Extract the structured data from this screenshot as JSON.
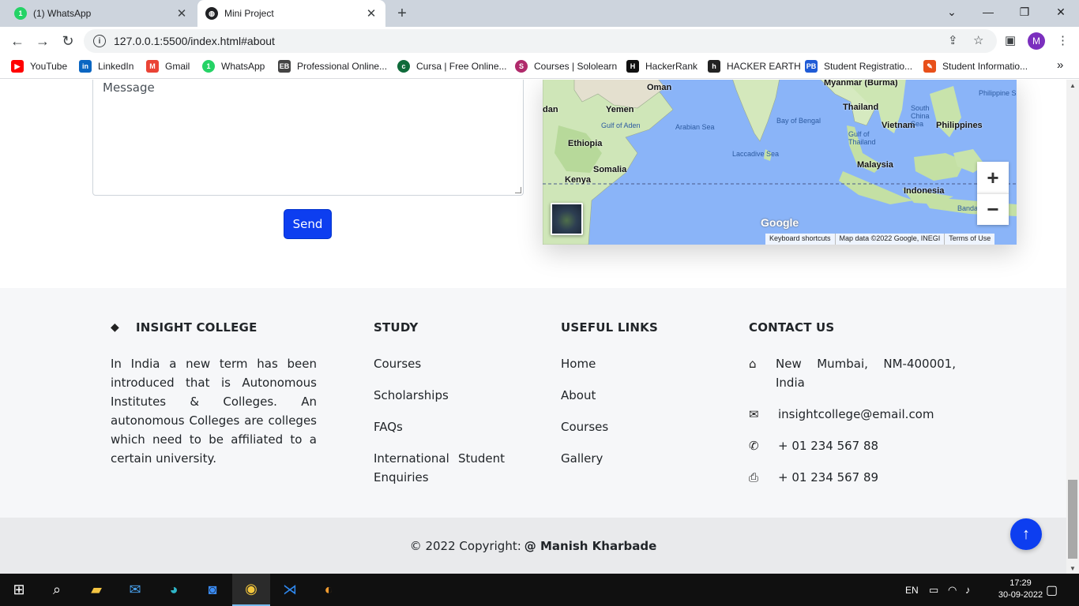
{
  "browser": {
    "tabs": [
      {
        "title": "(1) WhatsApp",
        "icon": "whatsapp-icon",
        "active": false
      },
      {
        "title": "Mini Project",
        "icon": "globe-icon",
        "active": true
      }
    ],
    "new_tab": "+",
    "url": "127.0.0.1:5500/index.html#about",
    "profile_initial": "M",
    "bookmarks": [
      {
        "label": "YouTube",
        "icon": "youtube-icon",
        "color": "#ff0000"
      },
      {
        "label": "LinkedIn",
        "icon": "linkedin-icon",
        "color": "#0a66c2"
      },
      {
        "label": "Gmail",
        "icon": "gmail-icon",
        "color": "#ea4335"
      },
      {
        "label": "WhatsApp",
        "icon": "whatsapp-icon",
        "color": "#25d366"
      },
      {
        "label": "Professional Online...",
        "icon": "eb-icon",
        "color": "#444444"
      },
      {
        "label": "Cursa | Free Online...",
        "icon": "cursa-icon",
        "color": "#0f6b3a"
      },
      {
        "label": "Courses | Sololearn",
        "icon": "sololearn-icon",
        "color": "#b02a6b"
      },
      {
        "label": "HackerRank",
        "icon": "hackerrank-icon",
        "color": "#111111"
      },
      {
        "label": "HACKER EARTH",
        "icon": "hackerearth-icon",
        "color": "#222222"
      },
      {
        "label": "Student Registratio...",
        "icon": "pb-icon",
        "color": "#1f5bd6"
      },
      {
        "label": "Student Informatio...",
        "icon": "pencil-icon",
        "color": "#e8501a"
      }
    ],
    "more_bookmarks": "»"
  },
  "contact_form": {
    "message_placeholder": "Message",
    "send_label": "Send"
  },
  "map": {
    "labels": [
      "Oman",
      "Yemen",
      "Ethiopia",
      "Somalia",
      "Kenya",
      "Thailand",
      "Vietnam",
      "Philippines",
      "Malaysia",
      "Indonesia",
      "Myanmar (Burma)",
      "dan"
    ],
    "seas": [
      "Gulf of Aden",
      "Arabian Sea",
      "Bay of Bengal",
      "Laccadive Sea",
      "South China Sea",
      "Gulf of Thailand",
      "Philippine S",
      "Banda"
    ],
    "zoom_in": "+",
    "zoom_out": "−",
    "logo": "Google",
    "footer": [
      "Keyboard shortcuts",
      "Map data ©2022 Google, INEGI",
      "Terms of Use"
    ]
  },
  "footer": {
    "brand": {
      "name": "INSIGHT COLLEGE",
      "icon": "gem-icon",
      "text": "In India a new term has been introduced that is Autonomous Institutes & Colleges. An autonomous Colleges are colleges which need to be affiliated to a certain university."
    },
    "study": {
      "heading": "STUDY",
      "links": [
        "Courses",
        "Scholarships",
        "FAQs",
        "International Student Enquiries"
      ]
    },
    "useful_links": {
      "heading": "USEFUL LINKS",
      "links": [
        "Home",
        "About",
        "Courses",
        "Gallery"
      ]
    },
    "contact": {
      "heading": "CONTACT US",
      "items": [
        {
          "icon": "home-icon",
          "text": "New Mumbai, NM-400001, India"
        },
        {
          "icon": "envelope-icon",
          "text": "insightcollege@email.com"
        },
        {
          "icon": "phone-icon",
          "text": "+ 01 234 567 88"
        },
        {
          "icon": "print-icon",
          "text": "+ 01 234 567 89"
        }
      ]
    },
    "copyright_prefix": "© 2022 Copyright:",
    "copyright_author": "@ Manish Kharbade",
    "back_to_top": "↑"
  },
  "taskbar": {
    "language": "EN",
    "time": "17:29",
    "date": "30-09-2022",
    "apps": [
      "windows-start-icon",
      "search-icon",
      "file-explorer-icon",
      "mail-icon",
      "edge-icon",
      "zoom-icon",
      "chrome-icon",
      "vscode-icon",
      "eclipse-icon"
    ]
  },
  "colors": {
    "accent": "#0d3ef0",
    "footer_bg": "#f6f7f9",
    "copy_bg": "#e9eaec"
  }
}
